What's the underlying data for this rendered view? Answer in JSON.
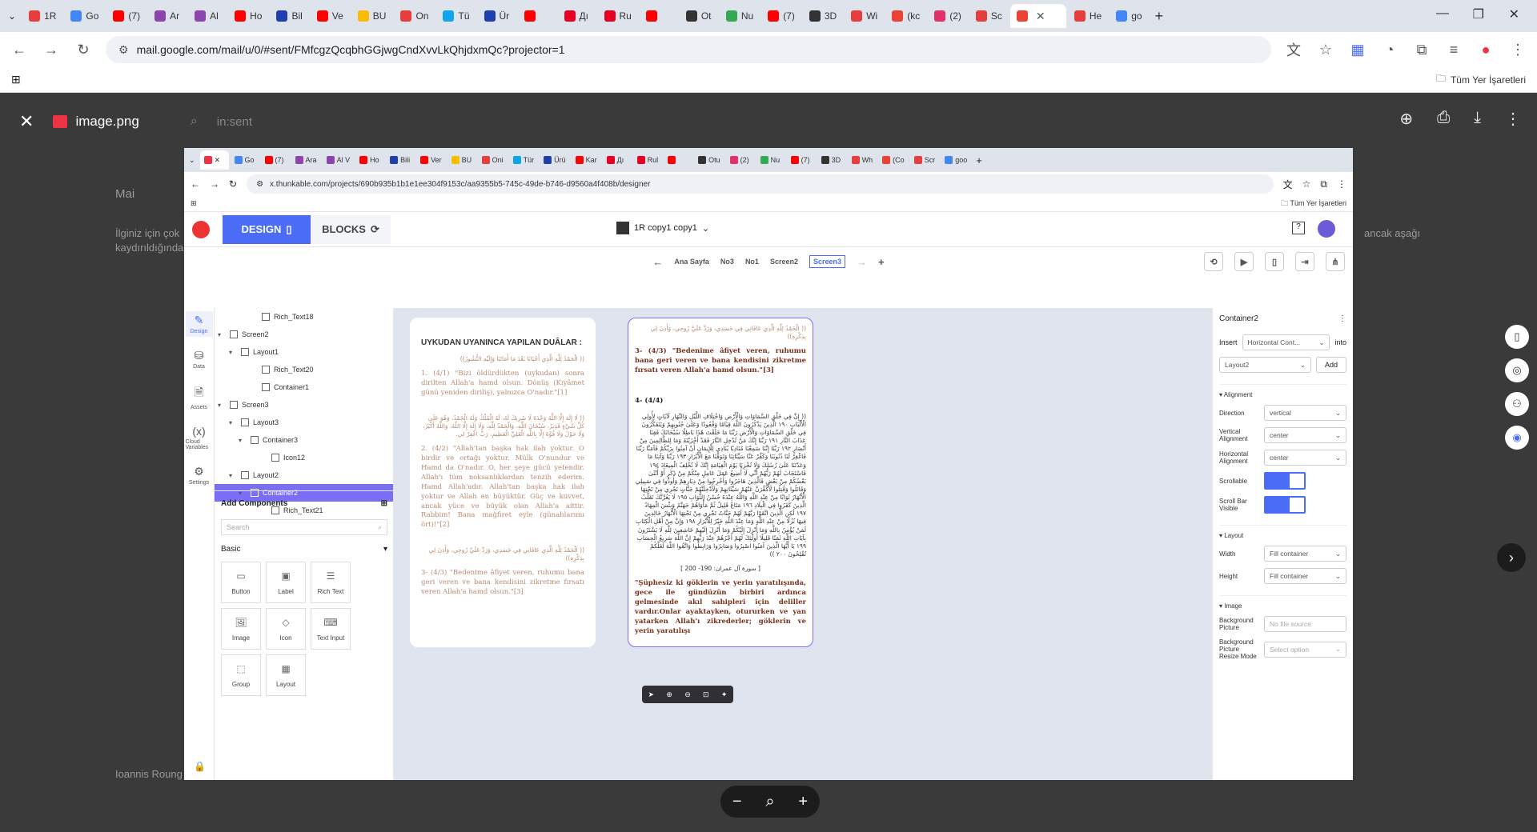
{
  "outer_browser": {
    "tabs": [
      {
        "label": "1R",
        "color": "#e53e3e"
      },
      {
        "label": "Go",
        "color": "#4285f4"
      },
      {
        "label": "(7)",
        "color": "#ff0000"
      },
      {
        "label": "Ar",
        "color": "#8e44ad"
      },
      {
        "label": "Al",
        "color": "#8e44ad"
      },
      {
        "label": "Ho",
        "color": "#ff0000"
      },
      {
        "label": "Bil",
        "color": "#1e40af"
      },
      {
        "label": "Ve",
        "color": "#ff0000"
      },
      {
        "label": "BU",
        "color": "#fbbc04"
      },
      {
        "label": "On",
        "color": "#e53e3e"
      },
      {
        "label": "Tü",
        "color": "#0ea5e9"
      },
      {
        "label": "Ür",
        "color": "#1e40af"
      },
      {
        "label": "",
        "color": "#ff0000"
      },
      {
        "label": "Дı",
        "color": "#e60023"
      },
      {
        "label": "Ru",
        "color": "#e60023"
      },
      {
        "label": "",
        "color": "#ff0000"
      },
      {
        "label": "Ot",
        "color": "#333333"
      },
      {
        "label": "Nu",
        "color": "#34a853"
      },
      {
        "label": "(7)",
        "color": "#ff0000"
      },
      {
        "label": "3D",
        "color": "#333333"
      },
      {
        "label": "Wi",
        "color": "#e53e3e"
      },
      {
        "label": "(kc",
        "color": "#ea4335"
      },
      {
        "label": "(2)",
        "color": "#e1306c"
      },
      {
        "label": "Sc",
        "color": "#e53e3e"
      },
      {
        "label": "",
        "color": "#ea4335",
        "active": true
      },
      {
        "label": "He",
        "color": "#e53e3e"
      },
      {
        "label": "go",
        "color": "#4285f4"
      }
    ],
    "url": "mail.google.com/mail/u/0/#sent/FMfcgzQcqbhGGjwgCndXvvLkQhjdxmQc?projector=1",
    "bookmarks_label": "Tüm Yer İşaretleri"
  },
  "viewer": {
    "title": "image.png",
    "search_placeholder": "in:sent",
    "ghost_sender": "Mai",
    "ghost_line1": "İlginiz için çok",
    "ghost_line2": "kaydırıldığında",
    "ghost_right": "ancak aşağı",
    "ghost_bottom": "Ioannis Roung"
  },
  "inner_browser": {
    "tabs": [
      "Go",
      "(7)",
      "Ara",
      "Al V",
      "Ho",
      "Bili",
      "Ver",
      "BU",
      "Oni",
      "Tür",
      "Ürü",
      "Kar",
      "Дı",
      "Rul",
      "",
      "Otu",
      "(2)",
      "Nu",
      "(7)",
      "3D",
      "Wh",
      "(Co",
      "Scr",
      "goo"
    ],
    "tab_colors": [
      "#4285f4",
      "#ff0000",
      "#8e44ad",
      "#8e44ad",
      "#ff0000",
      "#1e40af",
      "#ff0000",
      "#fbbc04",
      "#e53e3e",
      "#0ea5e9",
      "#1e40af",
      "#ff0000",
      "#e60023",
      "#e60023",
      "#ff0000",
      "#333333",
      "#e1306c",
      "#34a853",
      "#ff0000",
      "#333333",
      "#e53e3e",
      "#ea4335",
      "#e53e3e",
      "#4285f4"
    ],
    "url": "x.thunkable.com/projects/690b935b1b1e1ee304f9153c/aa9355b5-745c-49de-b746-d9560a4f408b/designer",
    "bookmarks_label": "Tüm Yer İşaretleri"
  },
  "thunkable": {
    "design_label": "DESIGN",
    "blocks_label": "BLOCKS",
    "project_name": "1R copy1 copy1",
    "screens": [
      "Ana Sayfa",
      "No3",
      "No1",
      "Screen2",
      "Screen3"
    ],
    "active_screen": "Screen3",
    "rail": [
      {
        "label": "Design",
        "icon": "✎",
        "active": true
      },
      {
        "label": "Data",
        "icon": "⛁"
      },
      {
        "label": "Assets",
        "icon": "🗎"
      },
      {
        "label": "Cloud Variables",
        "icon": "(x)"
      },
      {
        "label": "Settings",
        "icon": "⚙"
      }
    ],
    "tree": [
      {
        "label": "Rich_Text18",
        "indent": 44,
        "caret": ""
      },
      {
        "label": "Screen2",
        "indent": 4,
        "caret": "▾"
      },
      {
        "label": "Layout1",
        "indent": 18,
        "caret": "▾"
      },
      {
        "label": "Rich_Text20",
        "indent": 44,
        "caret": ""
      },
      {
        "label": "Container1",
        "indent": 44,
        "caret": ""
      },
      {
        "label": "Screen3",
        "indent": 4,
        "caret": "▾"
      },
      {
        "label": "Layout3",
        "indent": 18,
        "caret": "▾"
      },
      {
        "label": "Container3",
        "indent": 30,
        "caret": "▾"
      },
      {
        "label": "Icon12",
        "indent": 56,
        "caret": ""
      },
      {
        "label": "Layout2",
        "indent": 18,
        "caret": "▾"
      },
      {
        "label": "Container2",
        "indent": 30,
        "caret": "▾",
        "selected": true
      },
      {
        "label": "Rich_Text21",
        "indent": 56,
        "caret": ""
      }
    ],
    "add_components": "Add Components",
    "search_placeholder": "Search",
    "basic": "Basic",
    "components": [
      {
        "label": "Button",
        "icon": "▭"
      },
      {
        "label": "Label",
        "icon": "▣"
      },
      {
        "label": "Rich Text",
        "icon": "☰"
      },
      {
        "label": "Image",
        "icon": "🖼"
      },
      {
        "label": "Icon",
        "icon": "◇"
      },
      {
        "label": "Text Input",
        "icon": "⌨"
      },
      {
        "label": "Group",
        "icon": "⬚"
      },
      {
        "label": "Layout",
        "icon": "▦"
      }
    ]
  },
  "phone1": {
    "title": "UYKUDAN UYANINCA YAPILAN DUÂLAR :",
    "arabic1": "(( الْحَمْدُ لِلَّهِ الَّذِي أَحْيَانَا بَعْدَ مَا أَمَاتَنَا وَإِلَيْهِ النُّشُورُ))",
    "p1": "1. (4/1) \"Bizi öldürdükten (uykudan) sonra dirilten Allah'a hamd olsun. Dönüş (Kıyâmet günü yeniden diriliş), yalnızca O'nadır.\"[1]",
    "arabic2": "(( لَا إِلَهَ إِلَّا اللَّهُ وَحْدَهُ لَا شَرِيكَ لَهُ، لَهُ الْمُلْكُ وَلَهُ الْحَمْدُ، وَهُوَ عَلَى كُلِّ شَيْءٍ قَدِيرٌ، سُبْحَانَ اللَّهِ، وَالْحَمْدُ لِلَّهِ، وَلَا إِلَهَ إِلَّا اللَّهُ، وَاللَّهُ أَكْبَرُ، وَلَا حَوْلَ وَلَا قُوَّةَ إِلَّا بِاللَّهِ الْعَلِيِّ الْعَظِيمِ، رَبِّ اغْفِرْ لِي.",
    "p2": "2. (4/2) \"Allah'tan başka hak ilah yoktur. O birdir ve ortağı yoktur. Mülk O'nundur ve Hamd da O'nadır. O, her şeye gücü yetendir. Allah'ı tüm noksanlıklardan tenzih ederim. Hamd Allah'adır. Allah'tan başka hak ilah yoktur ve Allah en büyüktür. Güç ve kuvvet, ancak yüce ve büyük olan Allah'a aittir. Rabbim! Bana mağfiret eyle (günahlarımı ört)!\"[2]",
    "arabic3": "(( الْحَمْدُ لِلَّهِ الَّذِي عَافَانِي فِي جَسَدِي، وَرَدَّ عَلَيَّ رُوحِي، وَأَذِنَ لِي بِذِكْرِهِ))",
    "p3": "3- (4/3) \"Bedenime âfiyet veren, ruhumu bana geri veren ve bana kendisini zikretme fırsatı veren Allah'a hamd olsun.\"[3]"
  },
  "phone2": {
    "arabic_top": "(( الْحَمْدُ لِلَّهِ الَّذِي عَافَانِي فِي جَسَدِي، وَرَدَّ عَلَيَّ رُوحِي، وَأَذِنَ لِي بِذِكْرِهِ))",
    "p3": "3- (4/3) \"Bedenime âfiyet veren, ruhumu bana geri veren ve bana kendisini zikretme fırsatı veren Allah'a hamd olsun.\"[3]",
    "heading4": "4- (4/4)",
    "arabic_long": "(( إِنَّ فِي خَلْقِ السَّمَاوَاتِ وَالْأَرْضِ وَاخْتِلَافِ اللَّيْلِ وَالنَّهَارِ لَآيَاتٍ لِأُولِي الْأَلْبَابِ ١٩٠ الَّذِينَ يَذْكُرُونَ اللَّهَ قِيَامًا وَقُعُودًا وَعَلَىٰ جُنُوبِهِمْ وَيَتَفَكَّرُونَ فِي خَلْقِ السَّمَاوَاتِ وَالْأَرْضِ رَبَّنَا مَا خَلَقْتَ هَٰذَا بَاطِلًا سُبْحَانَكَ فَقِنَا عَذَابَ النَّارِ ١٩١ رَبَّنَا إِنَّكَ مَنْ تُدْخِلِ النَّارَ فَقَدْ أَخْزَيْتَهُ وَمَا لِلظَّالِمِينَ مِنْ أَنْصَارٍ ١٩٢ رَبَّنَا إِنَّنَا سَمِعْنَا مُنَادِيًا يُنَادِي لِلْإِيمَانِ أَنْ آمِنُوا بِرَبِّكُمْ فَآمَنَّا رَبَّنَا فَاغْفِرْ لَنَا ذُنُوبَنَا وَكَفِّرْ عَنَّا سَيِّئَاتِنَا وَتَوَفَّنَا مَعَ الْأَبْرَارِ ١٩٣ رَبَّنَا وَآتِنَا مَا وَعَدْتَنَا عَلَىٰ رُسُلِكَ وَلَا تُخْزِنَا يَوْمَ الْقِيَامَةِ إِنَّكَ لَا تُخْلِفُ الْمِيعَادَ ١٩٤ فَاسْتَجَابَ لَهُمْ رَبُّهُمْ أَنِّي لَا أُضِيعُ عَمَلَ عَامِلٍ مِنْكُمْ مِنْ ذَكَرٍ أَوْ أُنْثَىٰ بَعْضُكُمْ مِنْ بَعْضٍ فَالَّذِينَ هَاجَرُوا وَأُخْرِجُوا مِنْ دِيَارِهِمْ وَأُوذُوا فِي سَبِيلِي وَقَاتَلُوا وَقُتِلُوا لَأُكَفِّرَنَّ عَنْهُمْ سَيِّئَاتِهِمْ وَلَأُدْخِلَنَّهُمْ جَنَّاتٍ تَجْرِي مِنْ تَحْتِهَا الْأَنْهَارُ ثَوَابًا مِنْ عِنْدِ اللَّهِ وَاللَّهُ عِنْدَهُ حُسْنُ الثَّوَابِ ١٩٥ لَا يَغُرَّنَّكَ تَقَلُّبُ الَّذِينَ كَفَرُوا فِي الْبِلَادِ ١٩٦ مَتَاعٌ قَلِيلٌ ثُمَّ مَأْوَاهُمْ جَهَنَّمُ وَبِئْسَ الْمِهَادُ ١٩٧ لَٰكِنِ الَّذِينَ اتَّقَوْا رَبَّهُمْ لَهُمْ جَنَّاتٌ تَجْرِي مِنْ تَحْتِهَا الْأَنْهَارُ خَالِدِينَ فِيهَا نُزُلًا مِنْ عِنْدِ اللَّهِ وَمَا عِنْدَ اللَّهِ خَيْرٌ لِلْأَبْرَارِ ١٩٨ وَإِنَّ مِنْ أَهْلِ الْكِتَابِ لَمَنْ يُؤْمِنُ بِاللَّهِ وَمَا أُنْزِلَ إِلَيْكُمْ وَمَا أُنْزِلَ إِلَيْهِمْ خَاشِعِينَ لِلَّهِ لَا يَشْتَرُونَ بِآيَاتِ اللَّهِ ثَمَنًا قَلِيلًا أُولَٰئِكَ لَهُمْ أَجْرُهُمْ عِنْدَ رَبِّهِمْ إِنَّ اللَّهَ سَرِيعُ الْحِسَابِ ١٩٩ يَا أَيُّهَا الَّذِينَ آمَنُوا اصْبِرُوا وَصَابِرُوا وَرَابِطُوا وَاتَّقُوا اللَّهَ لَعَلَّكُمْ تُفْلِحُونَ ٢٠٠ ))",
    "surah": "[ سورة آل عمران: 190- 200 ]",
    "p4": "\"Şüphesiz ki göklerin ve yerin yaratılışında, gece ile gündüzün birbiri ardınca gelmesinde akıl sahipleri için deliller vardır.Onlar ayaktayken, otururken ve yan yatarken Allah'ı zikrederler; göklerin ve yerin yaratılışı"
  },
  "properties": {
    "component": "Container2",
    "insert_label": "Insert",
    "insert_value": "Horizontal Cont...",
    "into_label": "into",
    "target": "Layout2",
    "add_label": "Add",
    "alignment_section": "Alignment",
    "direction_label": "Direction",
    "direction_value": "vertical",
    "valign_label": "Vertical Alignment",
    "valign_value": "center",
    "halign_label": "Horizontal Alignment",
    "halign_value": "center",
    "scrollable_label": "Scrollable",
    "scrollbar_label": "Scroll Bar Visible",
    "layout_section": "Layout",
    "width_label": "Width",
    "width_value": "Fill container",
    "height_label": "Height",
    "height_value": "Fill container",
    "image_section": "Image",
    "bg_picture_label": "Background Picture",
    "bg_picture_placeholder": "No file source",
    "bg_resize_label": "Background Picture Resize Mode",
    "bg_resize_placeholder": "Select option"
  },
  "colors": {
    "accent": "#4a6cf7",
    "selected_row": "#7b6ef6",
    "text_brown": "#b98a70",
    "text_dark_red": "#7a2e1a"
  }
}
